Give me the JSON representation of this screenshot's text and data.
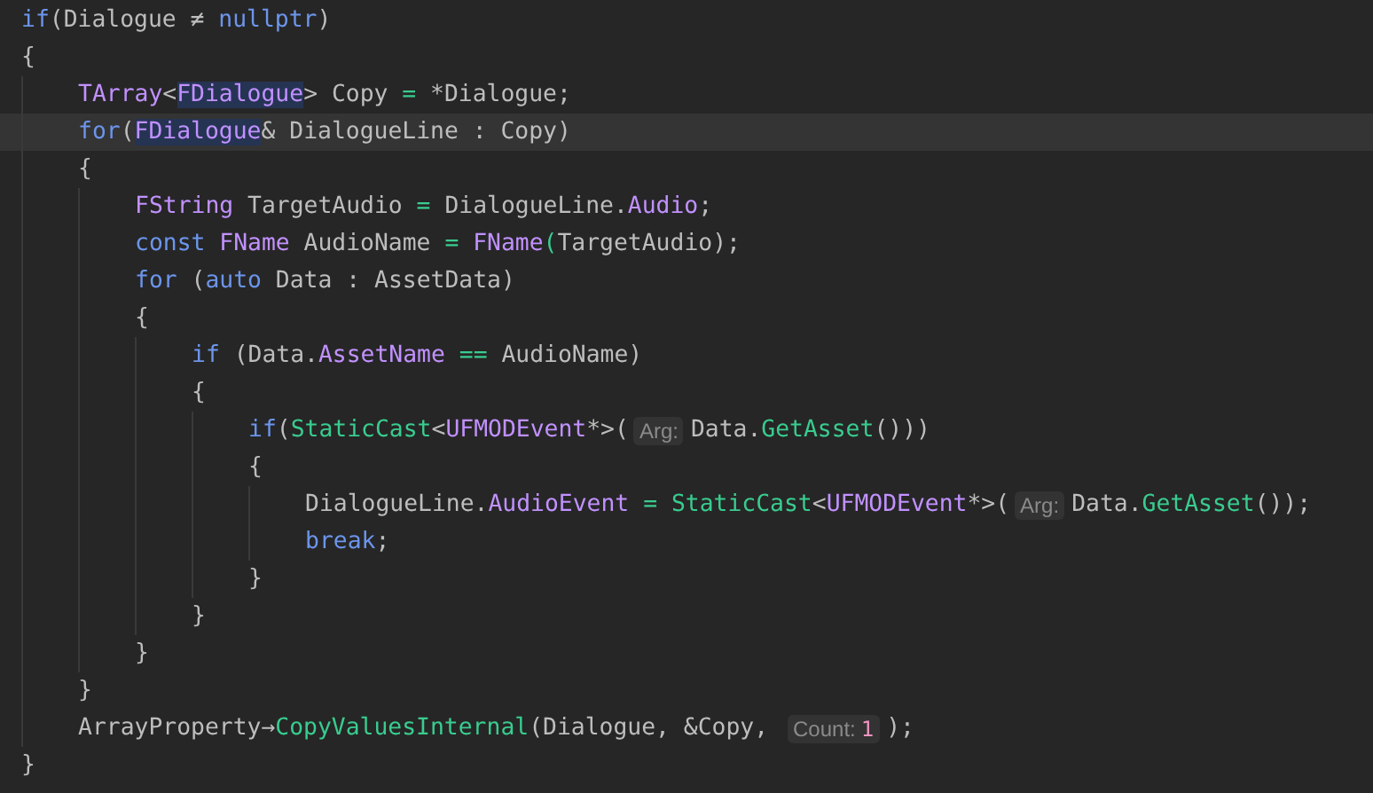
{
  "editor": {
    "lines": [
      {
        "current": false,
        "segments": [
          {
            "kind": "code",
            "tokens": [
              {
                "kind": "kw",
                "text": "if"
              },
              {
                "kind": "plain",
                "text": "(Dialogue ≠ "
              },
              {
                "kind": "kw",
                "text": "nullptr"
              },
              {
                "kind": "plain",
                "text": ")"
              }
            ]
          }
        ]
      },
      {
        "current": false,
        "segments": [
          {
            "kind": "code",
            "tokens": [
              {
                "kind": "plain",
                "text": "{"
              }
            ]
          }
        ],
        "children": [
          {
            "current": false,
            "segments": [
              {
                "kind": "code",
                "tokens": [
                  {
                    "kind": "type",
                    "text": "TArray"
                  },
                  {
                    "kind": "plain",
                    "text": "<"
                  },
                  {
                    "kind": "match",
                    "text": "FDialogue"
                  },
                  {
                    "kind": "plain",
                    "text": "> Copy "
                  },
                  {
                    "kind": "op",
                    "text": "="
                  },
                  {
                    "kind": "plain",
                    "text": " *Dialogue;"
                  }
                ]
              }
            ]
          },
          {
            "current": true,
            "segments": [
              {
                "kind": "code",
                "tokens": [
                  {
                    "kind": "kw",
                    "text": "for"
                  },
                  {
                    "kind": "plain",
                    "text": "("
                  },
                  {
                    "kind": "match",
                    "text": "FDialogue"
                  },
                  {
                    "kind": "plain",
                    "text": "& DialogueLine : Copy)"
                  }
                ]
              }
            ]
          },
          {
            "current": false,
            "segments": [
              {
                "kind": "code",
                "tokens": [
                  {
                    "kind": "plain",
                    "text": "{"
                  }
                ]
              }
            ],
            "children": [
              {
                "current": false,
                "segments": [
                  {
                    "kind": "code",
                    "tokens": [
                      {
                        "kind": "type",
                        "text": "FString"
                      },
                      {
                        "kind": "plain",
                        "text": " TargetAudio "
                      },
                      {
                        "kind": "op",
                        "text": "="
                      },
                      {
                        "kind": "plain",
                        "text": " DialogueLine."
                      },
                      {
                        "kind": "member",
                        "text": "Audio"
                      },
                      {
                        "kind": "plain",
                        "text": ";"
                      }
                    ]
                  }
                ]
              },
              {
                "current": false,
                "segments": [
                  {
                    "kind": "code",
                    "tokens": [
                      {
                        "kind": "kw",
                        "text": "const "
                      },
                      {
                        "kind": "type",
                        "text": "FName"
                      },
                      {
                        "kind": "plain",
                        "text": " AudioName "
                      },
                      {
                        "kind": "op",
                        "text": "= "
                      },
                      {
                        "kind": "type",
                        "text": "FName"
                      },
                      {
                        "kind": "op",
                        "text": "("
                      },
                      {
                        "kind": "plain",
                        "text": "TargetAudio);"
                      }
                    ]
                  }
                ]
              },
              {
                "current": false,
                "segments": [
                  {
                    "kind": "code",
                    "tokens": [
                      {
                        "kind": "kw",
                        "text": "for"
                      },
                      {
                        "kind": "plain",
                        "text": " ("
                      },
                      {
                        "kind": "kw",
                        "text": "auto"
                      },
                      {
                        "kind": "plain",
                        "text": " Data : AssetData)"
                      }
                    ]
                  }
                ]
              },
              {
                "current": false,
                "segments": [
                  {
                    "kind": "code",
                    "tokens": [
                      {
                        "kind": "plain",
                        "text": "{"
                      }
                    ]
                  }
                ],
                "children": [
                  {
                    "current": false,
                    "segments": [
                      {
                        "kind": "code",
                        "tokens": [
                          {
                            "kind": "kw",
                            "text": "if"
                          },
                          {
                            "kind": "plain",
                            "text": " (Data."
                          },
                          {
                            "kind": "member",
                            "text": "AssetName"
                          },
                          {
                            "kind": "op",
                            "text": " =="
                          },
                          {
                            "kind": "plain",
                            "text": " AudioName)"
                          }
                        ]
                      }
                    ]
                  },
                  {
                    "current": false,
                    "segments": [
                      {
                        "kind": "code",
                        "tokens": [
                          {
                            "kind": "plain",
                            "text": "{"
                          }
                        ]
                      }
                    ],
                    "children": [
                      {
                        "current": false,
                        "segments": [
                          {
                            "kind": "code",
                            "tokens": [
                              {
                                "kind": "kw",
                                "text": "if"
                              },
                              {
                                "kind": "plain",
                                "text": "("
                              },
                              {
                                "kind": "fn",
                                "text": "StaticCast"
                              },
                              {
                                "kind": "plain",
                                "text": "<"
                              },
                              {
                                "kind": "type",
                                "text": "UFMODEvent"
                              },
                              {
                                "kind": "plain",
                                "text": "*>("
                              }
                            ]
                          },
                          {
                            "kind": "hint",
                            "label": "Arg:"
                          },
                          {
                            "kind": "code",
                            "tokens": [
                              {
                                "kind": "plain",
                                "text": "Data."
                              },
                              {
                                "kind": "fn",
                                "text": "GetAsset"
                              },
                              {
                                "kind": "plain",
                                "text": "()))"
                              }
                            ]
                          }
                        ]
                      },
                      {
                        "current": false,
                        "segments": [
                          {
                            "kind": "code",
                            "tokens": [
                              {
                                "kind": "plain",
                                "text": "{"
                              }
                            ]
                          }
                        ],
                        "children": [
                          {
                            "current": false,
                            "segments": [
                              {
                                "kind": "code",
                                "tokens": [
                                  {
                                    "kind": "plain",
                                    "text": "DialogueLine."
                                  },
                                  {
                                    "kind": "member",
                                    "text": "AudioEvent"
                                  },
                                  {
                                    "kind": "op",
                                    "text": " = "
                                  },
                                  {
                                    "kind": "fn",
                                    "text": "StaticCast"
                                  },
                                  {
                                    "kind": "plain",
                                    "text": "<"
                                  },
                                  {
                                    "kind": "type",
                                    "text": "UFMODEvent"
                                  },
                                  {
                                    "kind": "plain",
                                    "text": "*>("
                                  }
                                ]
                              },
                              {
                                "kind": "hint",
                                "label": "Arg:"
                              },
                              {
                                "kind": "code",
                                "tokens": [
                                  {
                                    "kind": "plain",
                                    "text": "Data."
                                  },
                                  {
                                    "kind": "fn",
                                    "text": "GetAsset"
                                  },
                                  {
                                    "kind": "plain",
                                    "text": "());"
                                  }
                                ]
                              }
                            ]
                          },
                          {
                            "current": false,
                            "segments": [
                              {
                                "kind": "code",
                                "tokens": [
                                  {
                                    "kind": "kw",
                                    "text": "break"
                                  },
                                  {
                                    "kind": "plain",
                                    "text": ";"
                                  }
                                ]
                              }
                            ]
                          }
                        ]
                      },
                      {
                        "current": false,
                        "segments": [
                          {
                            "kind": "code",
                            "tokens": [
                              {
                                "kind": "plain",
                                "text": "}"
                              }
                            ]
                          }
                        ]
                      }
                    ]
                  },
                  {
                    "current": false,
                    "segments": [
                      {
                        "kind": "code",
                        "tokens": [
                          {
                            "kind": "plain",
                            "text": "}"
                          }
                        ]
                      }
                    ]
                  }
                ]
              },
              {
                "current": false,
                "segments": [
                  {
                    "kind": "code",
                    "tokens": [
                      {
                        "kind": "plain",
                        "text": "}"
                      }
                    ]
                  }
                ]
              }
            ]
          },
          {
            "current": false,
            "segments": [
              {
                "kind": "code",
                "tokens": [
                  {
                    "kind": "plain",
                    "text": "}"
                  }
                ]
              }
            ]
          },
          {
            "current": false,
            "segments": [
              {
                "kind": "code",
                "tokens": [
                  {
                    "kind": "plain",
                    "text": "ArrayProperty→"
                  },
                  {
                    "kind": "fn",
                    "text": "CopyValuesInternal"
                  },
                  {
                    "kind": "plain",
                    "text": "(Dialogue, &Copy, "
                  }
                ]
              },
              {
                "kind": "hint",
                "label": "Count:",
                "value": "1"
              },
              {
                "kind": "code",
                "tokens": [
                  {
                    "kind": "plain",
                    "text": ");"
                  }
                ]
              }
            ]
          }
        ]
      },
      {
        "current": false,
        "segments": [
          {
            "kind": "code",
            "tokens": [
              {
                "kind": "plain",
                "text": "}"
              }
            ]
          }
        ]
      }
    ]
  }
}
